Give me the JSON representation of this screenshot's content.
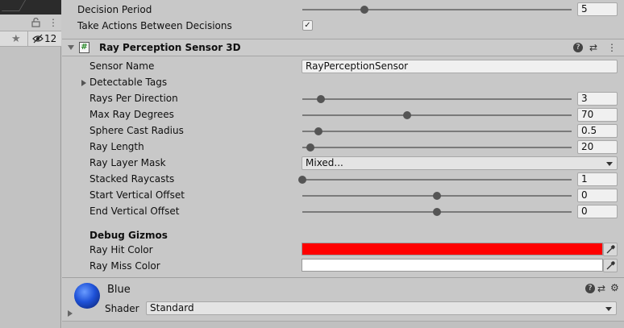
{
  "left_panel": {
    "kebab": "⋮",
    "hidden_count": "12"
  },
  "fields_top": {
    "decision_period": {
      "label": "Decision Period",
      "value": "5",
      "slider_fraction": 0.23
    },
    "take_actions": {
      "label": "Take Actions Between Decisions",
      "checked": "✓"
    }
  },
  "component": {
    "title": "Ray Perception Sensor 3D",
    "script_glyph": "#",
    "help": "?",
    "presets": "⇄",
    "menu": "⋮"
  },
  "sensor": {
    "sensor_name": {
      "label": "Sensor Name",
      "value": "RayPerceptionSensor"
    },
    "detectable_tags": {
      "label": "Detectable Tags"
    },
    "rays_per_direction": {
      "label": "Rays Per Direction",
      "value": "3",
      "slider_fraction": 0.07
    },
    "max_ray_degrees": {
      "label": "Max Ray Degrees",
      "value": "70",
      "slider_fraction": 0.39
    },
    "sphere_cast_radius": {
      "label": "Sphere Cast Radius",
      "value": "0.5",
      "slider_fraction": 0.06
    },
    "ray_length": {
      "label": "Ray Length",
      "value": "20",
      "slider_fraction": 0.03
    },
    "ray_layer_mask": {
      "label": "Ray Layer Mask",
      "value": "Mixed..."
    },
    "stacked_raycasts": {
      "label": "Stacked Raycasts",
      "value": "1",
      "slider_fraction": 0.0
    },
    "start_vertical_offset": {
      "label": "Start Vertical Offset",
      "value": "0",
      "slider_fraction": 0.5
    },
    "end_vertical_offset": {
      "label": "End Vertical Offset",
      "value": "0",
      "slider_fraction": 0.5
    }
  },
  "debug": {
    "section_title": "Debug Gizmos",
    "ray_hit_color": {
      "label": "Ray Hit Color",
      "color": "#ff0000"
    },
    "ray_miss_color": {
      "label": "Ray Miss Color",
      "color": "#ffffff"
    }
  },
  "material": {
    "name": "Blue",
    "shader_label": "Shader",
    "shader_value": "Standard",
    "help": "?",
    "presets": "⇄",
    "settings": "⚙"
  }
}
